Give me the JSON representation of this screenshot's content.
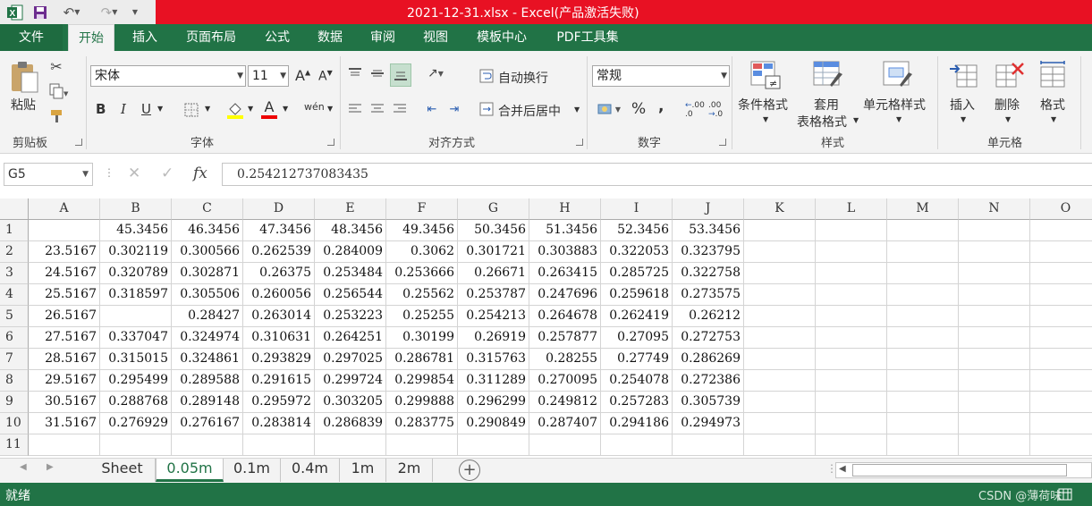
{
  "titlebar": {
    "title": "2021-12-31.xlsx -  Excel(产品激活失败)",
    "icons": [
      "excel-logo-icon",
      "save-icon",
      "undo-icon",
      "redo-icon",
      "customize-qat-icon"
    ]
  },
  "tabs": [
    {
      "label": "文件"
    },
    {
      "label": "开始"
    },
    {
      "label": "插入"
    },
    {
      "label": "页面布局"
    },
    {
      "label": "公式"
    },
    {
      "label": "数据"
    },
    {
      "label": "审阅"
    },
    {
      "label": "视图"
    },
    {
      "label": "模板中心"
    },
    {
      "label": "PDF工具集"
    }
  ],
  "ribbon": {
    "clipboard": {
      "paste": "粘贴",
      "label": "剪贴板"
    },
    "font": {
      "name": "宋体",
      "size": "11",
      "label": "字体",
      "bold": "B",
      "italic": "I",
      "underline": "U",
      "grow": "A",
      "shrink": "A",
      "font_color_letter": "A",
      "phonetic": "wén"
    },
    "alignment": {
      "wrap": "自动换行",
      "merge": "合并后居中",
      "label": "对齐方式"
    },
    "number": {
      "format": "常规",
      "percent": "%",
      "comma": ",",
      "inc": ".00",
      "dec": ".00",
      "label": "数字"
    },
    "styles": {
      "conditional": "条件格式",
      "table1": "套用",
      "table2": "表格格式",
      "cell": "单元格样式",
      "label": "样式"
    },
    "cells": {
      "insert": "插入",
      "delete": "删除",
      "format": "格式",
      "label": "单元格"
    }
  },
  "formula_bar": {
    "name_box": "G5",
    "fx": "fx",
    "value": "0.254212737083435"
  },
  "sheet": {
    "columns": [
      "A",
      "B",
      "C",
      "D",
      "E",
      "F",
      "G",
      "H",
      "I",
      "J",
      "K",
      "L",
      "M",
      "N",
      "O"
    ],
    "rows": [
      [
        "",
        "45.3456",
        "46.3456",
        "47.3456",
        "48.3456",
        "49.3456",
        "50.3456",
        "51.3456",
        "52.3456",
        "53.3456"
      ],
      [
        "23.5167",
        "0.302119",
        "0.300566",
        "0.262539",
        "0.284009",
        "0.3062",
        "0.301721",
        "0.303883",
        "0.322053",
        "0.323795"
      ],
      [
        "24.5167",
        "0.320789",
        "0.302871",
        "0.26375",
        "0.253484",
        "0.253666",
        "0.26671",
        "0.263415",
        "0.285725",
        "0.322758"
      ],
      [
        "25.5167",
        "0.318597",
        "0.305506",
        "0.260056",
        "0.256544",
        "0.25562",
        "0.253787",
        "0.247696",
        "0.259618",
        "0.273575"
      ],
      [
        "26.5167",
        "",
        "0.28427",
        "0.263014",
        "0.253223",
        "0.25255",
        "0.254213",
        "0.264678",
        "0.262419",
        "0.26212"
      ],
      [
        "27.5167",
        "0.337047",
        "0.324974",
        "0.310631",
        "0.264251",
        "0.30199",
        "0.26919",
        "0.257877",
        "0.27095",
        "0.272753"
      ],
      [
        "28.5167",
        "0.315015",
        "0.324861",
        "0.293829",
        "0.297025",
        "0.286781",
        "0.315763",
        "0.28255",
        "0.27749",
        "0.286269"
      ],
      [
        "29.5167",
        "0.295499",
        "0.289588",
        "0.291615",
        "0.299724",
        "0.299854",
        "0.311289",
        "0.270095",
        "0.254078",
        "0.272386"
      ],
      [
        "30.5167",
        "0.288768",
        "0.289148",
        "0.295972",
        "0.303205",
        "0.299888",
        "0.296299",
        "0.249812",
        "0.257283",
        "0.305739"
      ],
      [
        "31.5167",
        "0.276929",
        "0.276167",
        "0.283814",
        "0.286839",
        "0.283775",
        "0.290849",
        "0.287407",
        "0.294186",
        "0.294973"
      ],
      [
        "",
        "",
        "",
        "",
        "",
        "",
        "",
        "",
        "",
        ""
      ]
    ]
  },
  "sheet_tabs": [
    {
      "label": "Sheet"
    },
    {
      "label": "0.05m"
    },
    {
      "label": "0.1m"
    },
    {
      "label": "0.4m"
    },
    {
      "label": "1m"
    },
    {
      "label": "2m"
    }
  ],
  "status": {
    "text": "就绪",
    "watermark": "CSDN @薄荷味"
  },
  "colors": {
    "excel_green": "#217346",
    "title_red": "#e81123"
  }
}
